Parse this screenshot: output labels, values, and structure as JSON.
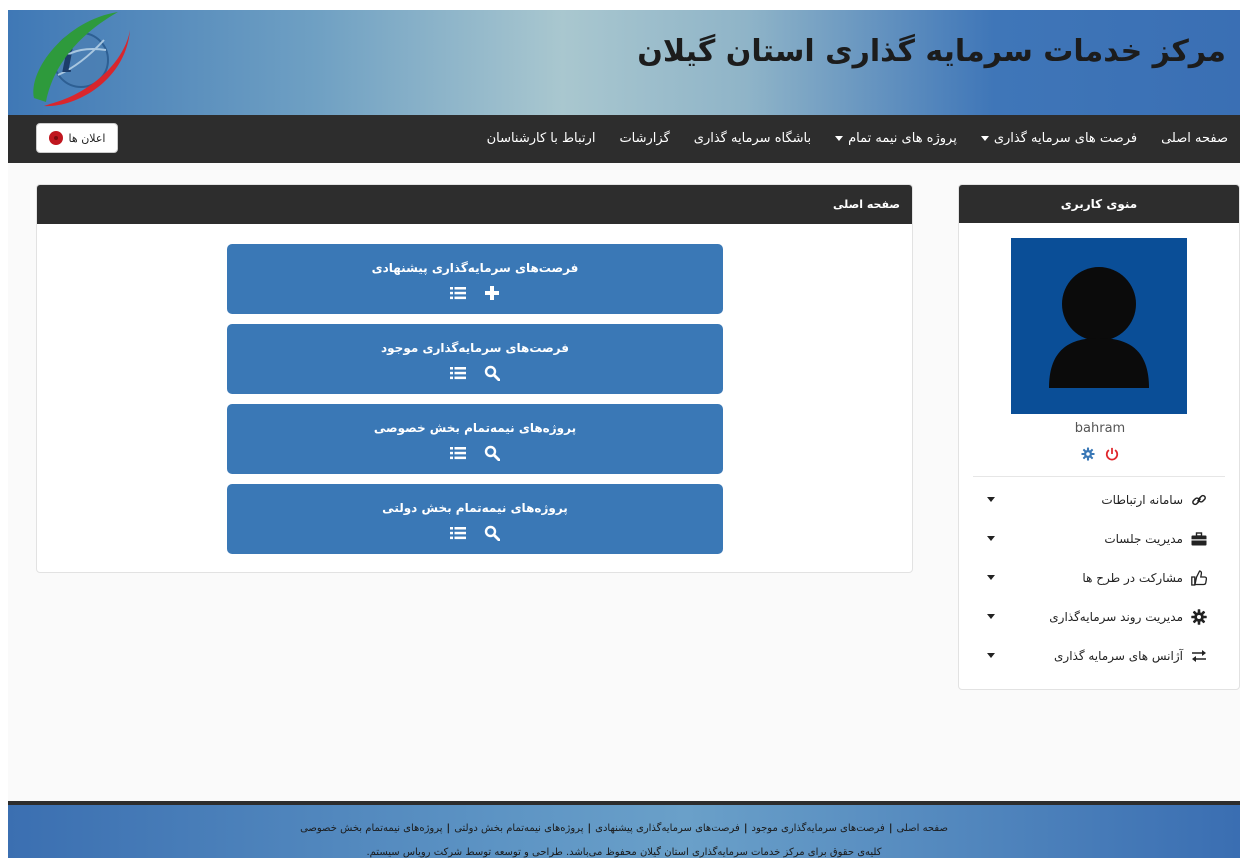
{
  "header": {
    "title": "مرکز خدمات سرمایه گذاری استان گیلان"
  },
  "navbar": {
    "items": [
      {
        "label": "صفحه اصلی",
        "dropdown": false
      },
      {
        "label": "فرصت های سرمایه گذاری",
        "dropdown": true
      },
      {
        "label": "پروژه های نیمه تمام",
        "dropdown": true
      },
      {
        "label": "باشگاه سرمایه گذاری",
        "dropdown": false
      },
      {
        "label": "گزارشات",
        "dropdown": false
      },
      {
        "label": "ارتباط با کارشناسان",
        "dropdown": false
      }
    ],
    "announcements_label": "اعلان ها"
  },
  "main": {
    "panel_title": "صفحه اصلی",
    "cards": [
      {
        "title": "فرصت‌های سرمایه‌گذاری پیشنهادی",
        "icons": [
          "list-icon",
          "plus-icon"
        ]
      },
      {
        "title": "فرصت‌های سرمایه‌گذاری موجود",
        "icons": [
          "list-icon",
          "search-icon"
        ]
      },
      {
        "title": "پروژه‌های نیمه‌تمام بخش خصوصی",
        "icons": [
          "list-icon",
          "search-icon"
        ]
      },
      {
        "title": "پروژه‌های نیمه‌تمام بخش دولتی",
        "icons": [
          "list-icon",
          "search-icon"
        ]
      }
    ]
  },
  "sidebar": {
    "title": "منوی کاربری",
    "username": "bahram",
    "items": [
      {
        "label": "سامانه ارتباطات",
        "icon": "link-icon"
      },
      {
        "label": "مدیریت جلسات",
        "icon": "briefcase-icon"
      },
      {
        "label": "مشارکت در طرح ها",
        "icon": "thumbs-up-icon"
      },
      {
        "label": "مدیریت روند سرمایه‌گذاری",
        "icon": "gear-icon"
      },
      {
        "label": "آژانس های سرمایه گذاری",
        "icon": "exchange-icon"
      }
    ]
  },
  "footer": {
    "links": [
      "صفحه اصلی",
      "فرصت‌های سرمایه‌گذاری موجود",
      "فرصت‌های سرمایه‌گذاری پیشنهادی",
      "پروژه‌های نیمه‌تمام بخش دولتی",
      "پروژه‌های نیمه‌تمام بخش خصوصی"
    ],
    "copyright": "کلیه‌ی حقوق برای مرکز خدمات سرمایه‌گذاری استان گیلان محفوظ می‌باشد. طراحی و توسعه توسط شرکت رویاس سیستم."
  },
  "colors": {
    "navbar": "#2d2d2d",
    "card": "#3a78b6",
    "avatar_bg": "#0a4e97",
    "power_red": "#e0262b",
    "gear_blue": "#3a78b6"
  }
}
